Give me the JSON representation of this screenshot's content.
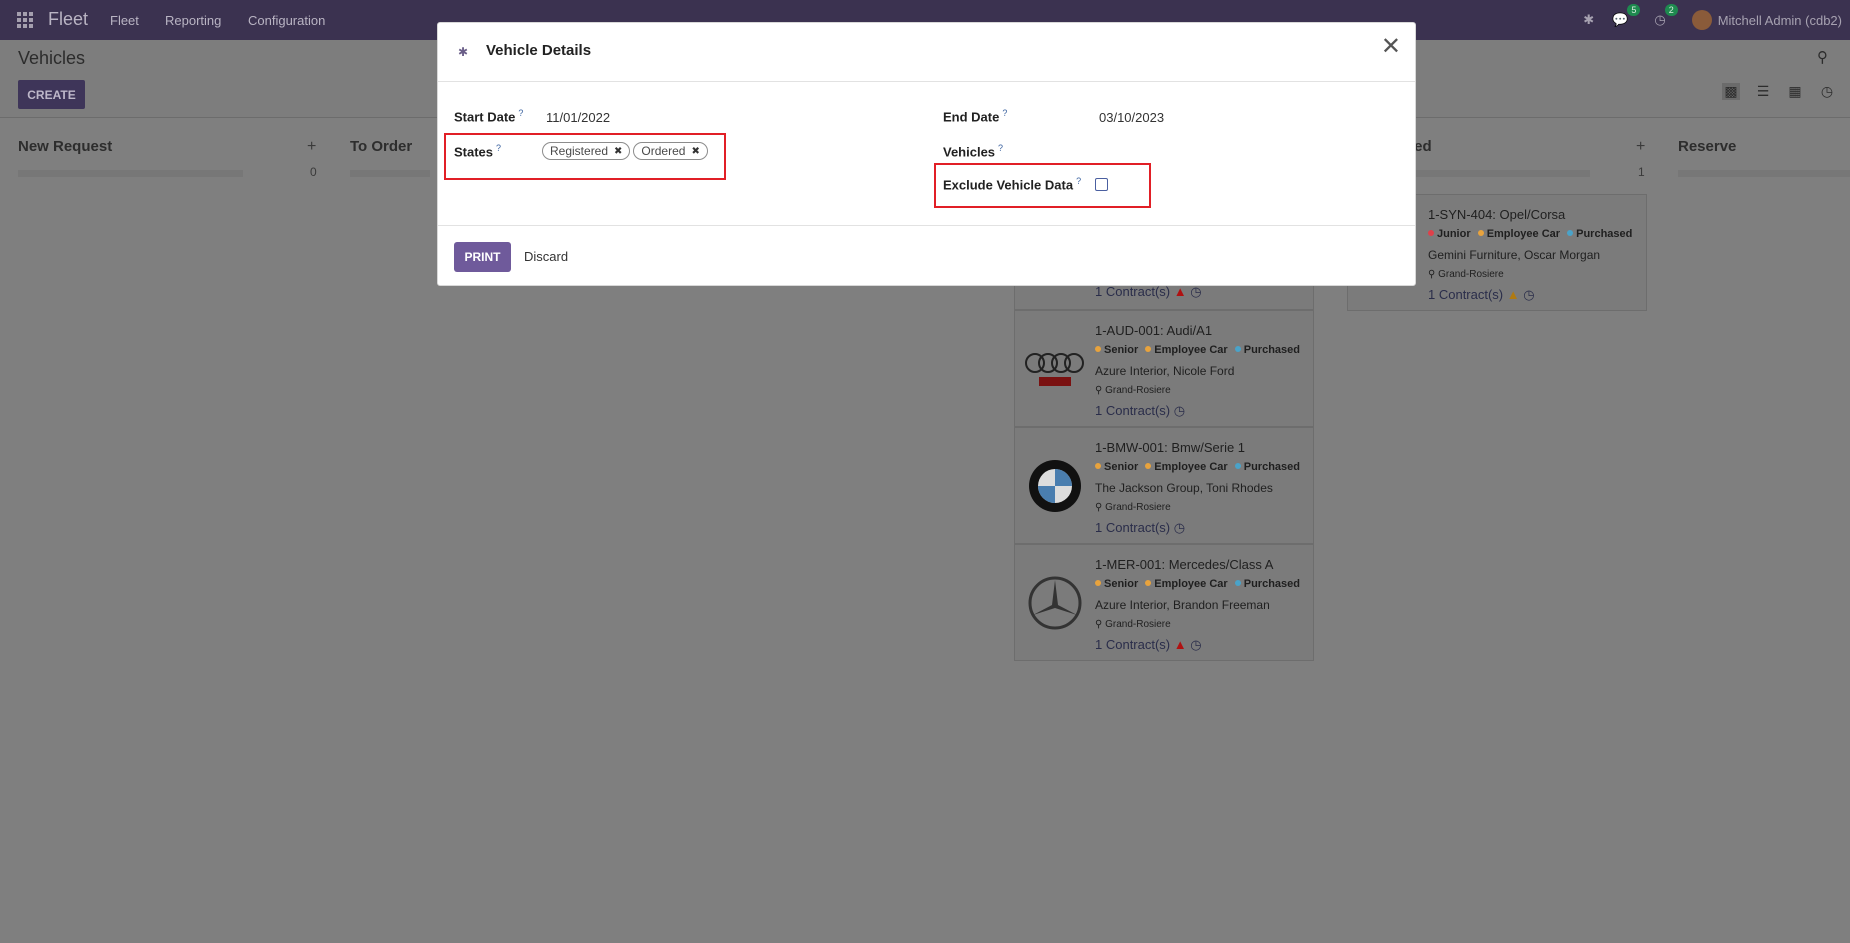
{
  "topbar": {
    "brand": "Fleet",
    "menu": [
      "Fleet",
      "Reporting",
      "Configuration"
    ],
    "chat_count": "5",
    "activity_count": "2",
    "user": "Mitchell Admin (cdb2)"
  },
  "control": {
    "title": "Vehicles",
    "create_label": "CREATE"
  },
  "kanban": {
    "columns": [
      {
        "title": "New Request",
        "count": "0"
      },
      {
        "title": "To Order",
        "count": ""
      },
      {
        "title": "ded",
        "count": "1"
      },
      {
        "title": "Reserve",
        "count": ""
      }
    ],
    "cards": [
      {
        "title": "1-AUD-001: Audi/A1",
        "tags": [
          "Senior",
          "Employee Car",
          "Purchased"
        ],
        "people": "Azure Interior, Nicole Ford",
        "location": "Grand-Rosiere",
        "contracts": "1 Contract(s)",
        "logo": "audi-logo"
      },
      {
        "title": "1-BMW-001: Bmw/Serie 1",
        "tags": [
          "Senior",
          "Employee Car",
          "Purchased"
        ],
        "people": "The Jackson Group, Toni Rhodes",
        "location": "Grand-Rosiere",
        "contracts": "1 Contract(s)",
        "logo": "bmw-logo"
      },
      {
        "title": "1-MER-001: Mercedes/Class A",
        "tags": [
          "Senior",
          "Employee Car",
          "Purchased"
        ],
        "people": "Azure Interior, Brandon Freeman",
        "location": "Grand-Rosiere",
        "contracts": "1 Contract(s)",
        "logo": "mercedes-logo"
      },
      {
        "title": "1-SYN-404: Opel/Corsa",
        "tags": [
          "Junior",
          "Employee Car",
          "Purchased"
        ],
        "people": "Gemini Furniture, Oscar Morgan",
        "location": "Grand-Rosiere",
        "contracts": "1 Contract(s)"
      },
      {
        "contracts": "1 Contract(s)"
      }
    ]
  },
  "modal": {
    "title": "Vehicle Details",
    "start_date_label": "Start Date",
    "start_date": "11/01/2022",
    "end_date_label": "End Date",
    "end_date": "03/10/2023",
    "states_label": "States",
    "states": [
      "Registered",
      "Ordered"
    ],
    "vehicles_label": "Vehicles",
    "exclude_label": "Exclude Vehicle Data",
    "exclude_checked": false,
    "help_mark": "?",
    "print_label": "PRINT",
    "discard_label": "Discard"
  },
  "colors": {
    "accent": "#714B67",
    "print": "#6f5a9b",
    "highlight": "#e11f26",
    "tag_senior": "#e8a33d",
    "tag_junior": "#e0404a",
    "tag_employee": "#e8a33d",
    "tag_purchased": "#4aa3c9"
  }
}
